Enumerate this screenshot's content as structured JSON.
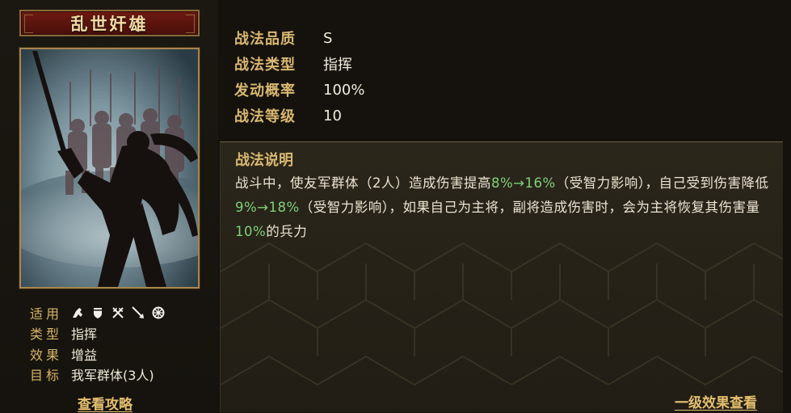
{
  "skill": {
    "name": "乱世奸雄",
    "info": {
      "suitable_label": "适用",
      "suitable_icons": [
        "cavalry-icon",
        "shield-icon",
        "crossed-bows-icon",
        "spear-icon",
        "wheel-icon"
      ],
      "type_label": "类型",
      "type_value": "指挥",
      "effect_label": "效果",
      "effect_value": "增益",
      "target_label": "目标",
      "target_value": "我军群体(3人)"
    },
    "strategy_link": "查看攻略"
  },
  "attributes": [
    {
      "label": "战法品质",
      "value": "S"
    },
    {
      "label": "战法类型",
      "value": "指挥"
    },
    {
      "label": "发动概率",
      "value": "100%"
    },
    {
      "label": "战法等级",
      "value": "10"
    }
  ],
  "description": {
    "title": "战法说明",
    "seg1": "战斗中，使友军群体（2人）造成伤害提高",
    "hl1": "8%→16%",
    "seg2": "（受智力影响），自己受到伤害降低",
    "hl2": "9%→18%",
    "seg3": "（受智力影响），如果自己为主将，副将造成伤害时，会为主将恢复其伤害量",
    "hl3": "10%",
    "seg4": "的兵力"
  },
  "effect_link": "一级效果查看",
  "colors": {
    "accent_gold": "#d9b871",
    "highlight_green": "#7fd07a",
    "title_red": "#6d1a12"
  }
}
